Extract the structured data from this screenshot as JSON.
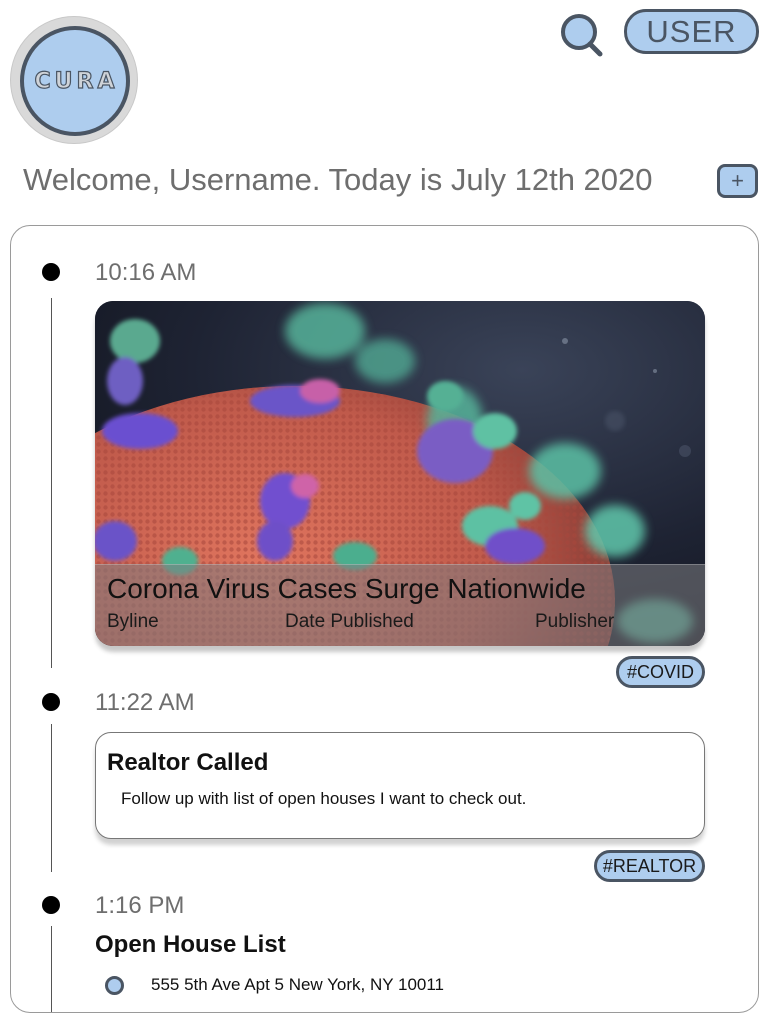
{
  "header": {
    "logo_text": "CURA",
    "user_label": "USER",
    "welcome_text": "Welcome, Username. Today is July 12th 2020",
    "add_label": "+"
  },
  "timeline": {
    "entries": [
      {
        "time": "10:16 AM",
        "news": {
          "title": "Corona Virus Cases Surge Nationwide",
          "byline": "Byline",
          "date_published": "Date Published",
          "publisher": "Publisher"
        },
        "tag": "#COVID"
      },
      {
        "time": "11:22 AM",
        "note": {
          "title": "Realtor Called",
          "body": "Follow up with list of open houses I want to check out."
        },
        "tag": "#REALTOR"
      },
      {
        "time": "1:16 PM",
        "list": {
          "title": "Open House List",
          "items": [
            "555 5th Ave Apt 5 New York, NY 10011"
          ]
        }
      }
    ]
  },
  "colors": {
    "accent": "#aecdee",
    "outline": "#4a5563",
    "muted_text": "#6e6e6e"
  },
  "icons": {
    "search": "search-icon",
    "add": "plus-icon"
  }
}
